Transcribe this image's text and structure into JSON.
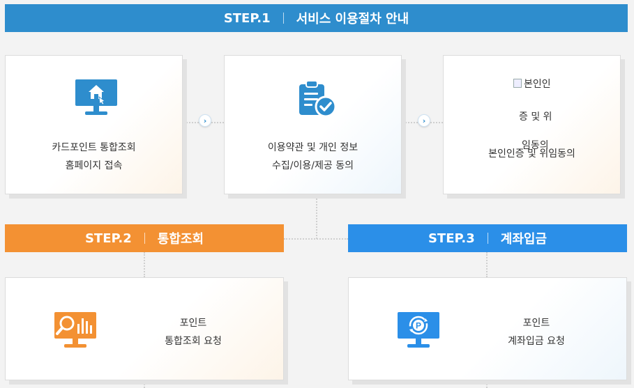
{
  "step1": {
    "step": "STEP.1",
    "title": "서비스 이용절차 안내"
  },
  "step2": {
    "step": "STEP.2",
    "title": "통합조회"
  },
  "step3": {
    "step": "STEP.3",
    "title": "계좌입금"
  },
  "cards": {
    "homepage": {
      "line1": "카드포인트 통합조회",
      "line2": "홈페이지 접속",
      "icon": "monitor-home-icon"
    },
    "consent": {
      "line1": "이용약관 및 개인 정보",
      "line2": "수집/이용/제공 동의",
      "icon": "clipboard-check-icon"
    },
    "auth": {
      "alt_line1": "본인인",
      "alt_line2": "증 및 위",
      "alt_line3": "임동의",
      "label": "본인인증 및 위임동의"
    },
    "inquiry": {
      "line1": "포인트",
      "line2": "통합조회 요청",
      "icon": "monitor-search-chart-icon"
    },
    "deposit": {
      "line1": "포인트",
      "line2": "계좌입금 요청",
      "icon": "monitor-point-icon"
    }
  },
  "colors": {
    "step1": "#2e8dcd",
    "step2": "#f39133",
    "step3": "#2b8fe8"
  }
}
